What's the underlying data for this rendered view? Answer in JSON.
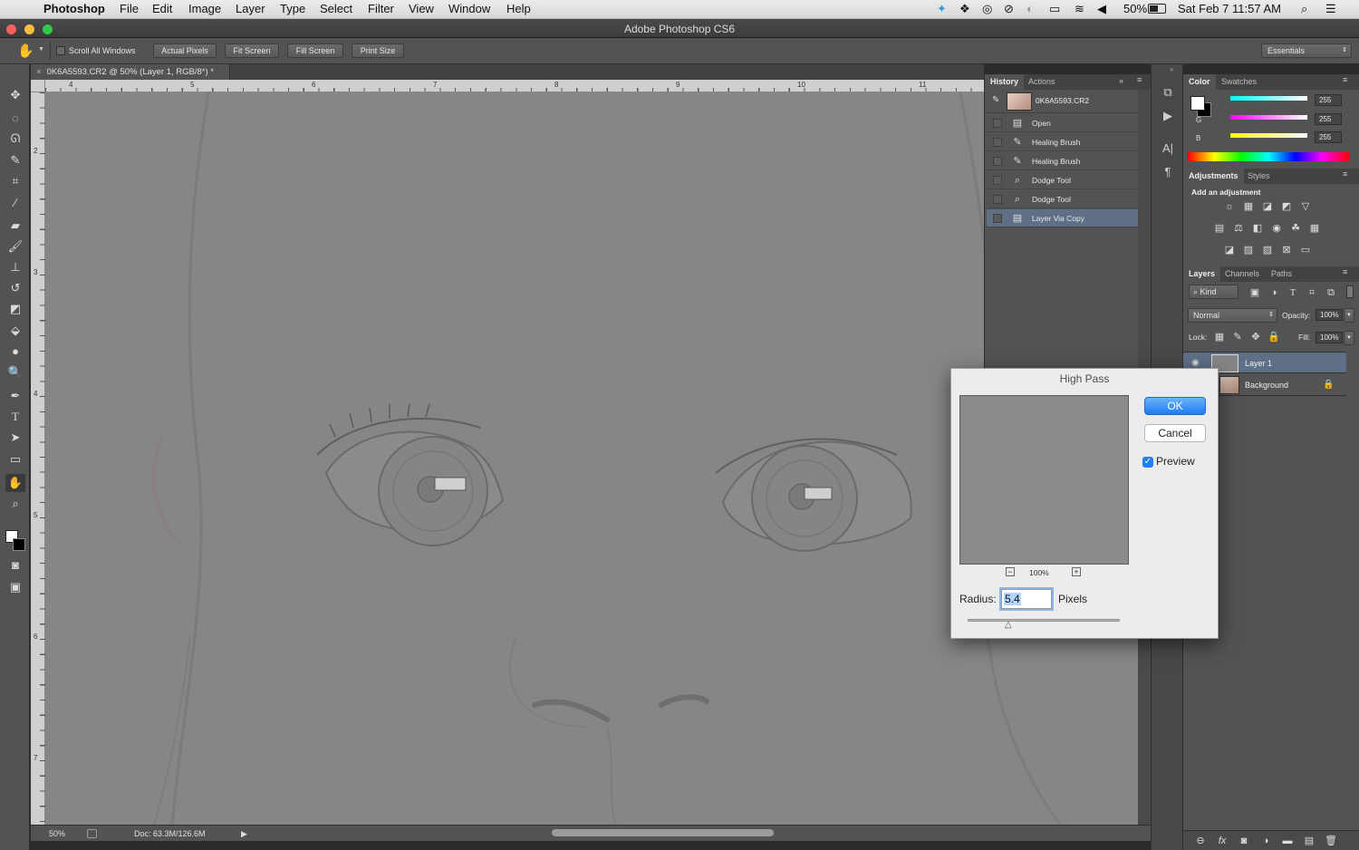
{
  "menubar": {
    "app": "Photoshop",
    "items": [
      "File",
      "Edit",
      "Image",
      "Layer",
      "Type",
      "Select",
      "Filter",
      "View",
      "Window",
      "Help"
    ],
    "battery": "50%",
    "datetime": "Sat Feb 7  11:57 AM"
  },
  "window": {
    "title": "Adobe Photoshop CS6"
  },
  "options": {
    "scroll_all": "Scroll All Windows",
    "actual_pixels": "Actual Pixels",
    "fit_screen": "Fit Screen",
    "fill_screen": "Fill Screen",
    "print_size": "Print Size",
    "workspace": "Essentials"
  },
  "document": {
    "tab": "0K6A5593.CR2 @ 50% (Layer 1, RGB/8*) *",
    "ruler_top": [
      "4",
      "5",
      "6",
      "7",
      "8",
      "9",
      "10",
      "11"
    ],
    "ruler_left": [
      "2",
      "3",
      "4",
      "5",
      "6",
      "7"
    ],
    "zoom": "50%",
    "doc_size": "Doc: 63.3M/126.6M"
  },
  "history": {
    "tabs": [
      "History",
      "Actions"
    ],
    "snapshot": "0K6A5593.CR2",
    "items": [
      "Open",
      "Healing Brush",
      "Healing Brush",
      "Dodge Tool",
      "Dodge Tool",
      "Layer Via Copy"
    ]
  },
  "color": {
    "tabs": [
      "Color",
      "Swatches"
    ],
    "r_label": "R",
    "g_label": "G",
    "b_label": "B",
    "r": "255",
    "g": "255",
    "b": "255"
  },
  "adjustments": {
    "tabs": [
      "Adjustments",
      "Styles"
    ],
    "heading": "Add an adjustment"
  },
  "layers": {
    "tabs": [
      "Layers",
      "Channels",
      "Paths"
    ],
    "kind": "Kind",
    "blend_mode": "Normal",
    "opacity_label": "Opacity:",
    "opacity": "100%",
    "lock_label": "Lock:",
    "fill_label": "Fill:",
    "fill": "100%",
    "items": [
      "Layer 1",
      "Background"
    ]
  },
  "dialog": {
    "title": "High Pass",
    "ok": "OK",
    "cancel": "Cancel",
    "preview_label": "Preview",
    "preview_checked": true,
    "zoom": "100%",
    "radius_label": "Radius:",
    "radius_value": "5.4",
    "unit": "Pixels"
  }
}
